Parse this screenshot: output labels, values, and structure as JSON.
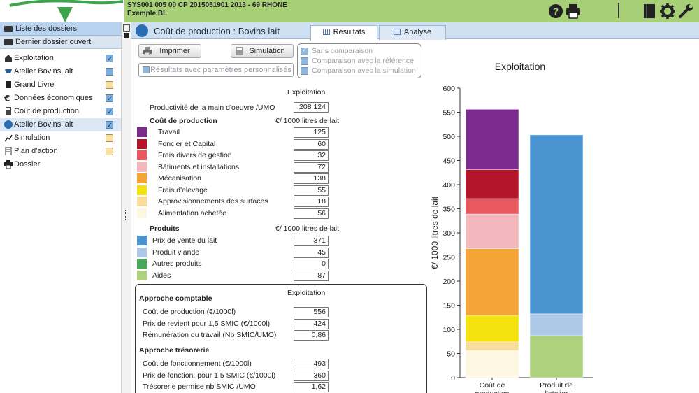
{
  "header": {
    "reference": "SYS001 005 00 CP 2015051901 2013 - 69  RHONE",
    "subtitle": "Exemple BL",
    "icons": [
      "help-icon",
      "print-icon",
      "book-icon",
      "gear-icon",
      "wrench-icon"
    ]
  },
  "sidebar": {
    "list_label": "Liste des dossiers",
    "last_label": "Dernier dossier ouvert",
    "items": [
      {
        "label": "Exploitation",
        "icon": "house-icon",
        "box": "blue",
        "checked": true
      },
      {
        "label": "Atelier Bovins lait",
        "icon": "cow-icon",
        "box": "blue",
        "checked": false
      },
      {
        "label": "Grand Livre",
        "icon": "book-icon",
        "box": "yellow",
        "checked": false
      },
      {
        "label": "Données économiques",
        "icon": "euro-icon",
        "box": "blue",
        "checked": true
      },
      {
        "label": "Coût de production",
        "icon": "calculator-icon",
        "box": "blue",
        "checked": true
      },
      {
        "label": "Atelier Bovins lait",
        "icon": "truck-icon",
        "box": "blue",
        "checked": true,
        "active": true
      },
      {
        "label": "Simulation",
        "icon": "trend-icon",
        "box": "yellow",
        "checked": false
      },
      {
        "label": "Plan d'action",
        "icon": "document-icon",
        "box": "yellow",
        "checked": false
      },
      {
        "label": "Dossier",
        "icon": "printer-icon",
        "box": "",
        "checked": false
      }
    ]
  },
  "main": {
    "title": "Coût de production : Bovins lait",
    "tabs": [
      {
        "label": "Résultats",
        "active": true
      },
      {
        "label": "Analyse",
        "active": false
      }
    ],
    "buttons": {
      "print": "Imprimer",
      "simulation": "Simulation",
      "custom_results": "Résultats avec paramètres personnalisés"
    },
    "options": [
      {
        "label": "Sans comparaison",
        "checked": true
      },
      {
        "label": "Comparaison avec la référence",
        "checked": false
      },
      {
        "label": "Comparaison avec la simulation",
        "checked": false
      }
    ]
  },
  "table": {
    "column_header": "Exploitation",
    "productivity": {
      "label": "Productivité de la main d'oeuvre /UMO",
      "value": "208 124"
    },
    "cost_section": {
      "title": "Coût de production",
      "unit": "€/ 1000 litres de lait"
    },
    "cost_items": [
      {
        "label": "Travail",
        "value": "125",
        "color": "#7b2a8e"
      },
      {
        "label": "Foncier et Capital",
        "value": "60",
        "color": "#b5152b"
      },
      {
        "label": "Frais divers de gestion",
        "value": "32",
        "color": "#e8595f"
      },
      {
        "label": "Bâtiments et installations",
        "value": "72",
        "color": "#f2b8bd"
      },
      {
        "label": "Mécanisation",
        "value": "138",
        "color": "#f4a535"
      },
      {
        "label": "Frais d'elevage",
        "value": "55",
        "color": "#f4e20f"
      },
      {
        "label": "Approvisionnements des surfaces",
        "value": "18",
        "color": "#f9dd9c"
      },
      {
        "label": "Alimentation achetée",
        "value": "56",
        "color": "#fdf6e0"
      }
    ],
    "product_section": {
      "title": "Produits",
      "unit": "€/ 1000 litres de lait"
    },
    "product_items": [
      {
        "label": "Prix de vente du lait",
        "value": "371",
        "color": "#4b94d2"
      },
      {
        "label": "Produit viande",
        "value": "45",
        "color": "#aec8e8"
      },
      {
        "label": "Autres produits",
        "value": "0",
        "color": "#4aa85a"
      },
      {
        "label": "Aides",
        "value": "87",
        "color": "#aed17e"
      }
    ]
  },
  "approche": {
    "column_header": "Exploitation",
    "comptable_title": "Approche comptable",
    "comptable": [
      {
        "label": "Coût de production (€/1000l)",
        "value": "556"
      },
      {
        "label": "Prix de revient pour 1,5 SMIC (€/1000l)",
        "value": "424"
      },
      {
        "label": "Rémunération du travail (Nb SMIC/UMO)",
        "value": "0,86"
      }
    ],
    "tresorerie_title": "Approche trésorerie",
    "tresorerie": [
      {
        "label": "Coût de fonctionnement (€/1000l)",
        "value": "493"
      },
      {
        "label": "Prix de fonction. pour 1,5 SMIC (€/1000l)",
        "value": "360"
      },
      {
        "label": "Trésorerie permise nb SMIC /UMO",
        "value": "1,62"
      }
    ]
  },
  "chart_data": {
    "type": "bar",
    "stacked": true,
    "title": "Exploitation",
    "ylabel": "€/ 1000 litres de lait",
    "ylim": [
      0,
      600
    ],
    "yticks": [
      0,
      50,
      100,
      150,
      200,
      250,
      300,
      350,
      400,
      450,
      500,
      550,
      600
    ],
    "categories": [
      "Coût de production",
      "Produit de l'atelier"
    ],
    "series": [
      {
        "name": "Alimentation achetée",
        "color": "#fdf6e0",
        "values": [
          56,
          0
        ]
      },
      {
        "name": "Approvisionnements des surfaces",
        "color": "#f9dd9c",
        "values": [
          18,
          0
        ]
      },
      {
        "name": "Frais d'elevage",
        "color": "#f4e20f",
        "values": [
          55,
          0
        ]
      },
      {
        "name": "Mécanisation",
        "color": "#f4a535",
        "values": [
          138,
          0
        ]
      },
      {
        "name": "Bâtiments et installations",
        "color": "#f2b8bd",
        "values": [
          72,
          0
        ]
      },
      {
        "name": "Frais divers de gestion",
        "color": "#e8595f",
        "values": [
          32,
          0
        ]
      },
      {
        "name": "Foncier et Capital",
        "color": "#b5152b",
        "values": [
          60,
          0
        ]
      },
      {
        "name": "Travail",
        "color": "#7b2a8e",
        "values": [
          125,
          0
        ]
      },
      {
        "name": "Aides",
        "color": "#aed17e",
        "values": [
          0,
          87
        ]
      },
      {
        "name": "Autres produits",
        "color": "#4aa85a",
        "values": [
          0,
          0
        ]
      },
      {
        "name": "Produit viande",
        "color": "#aec8e8",
        "values": [
          0,
          45
        ]
      },
      {
        "name": "Prix de vente du lait",
        "color": "#4b94d2",
        "values": [
          0,
          371
        ]
      }
    ],
    "grid": false
  }
}
